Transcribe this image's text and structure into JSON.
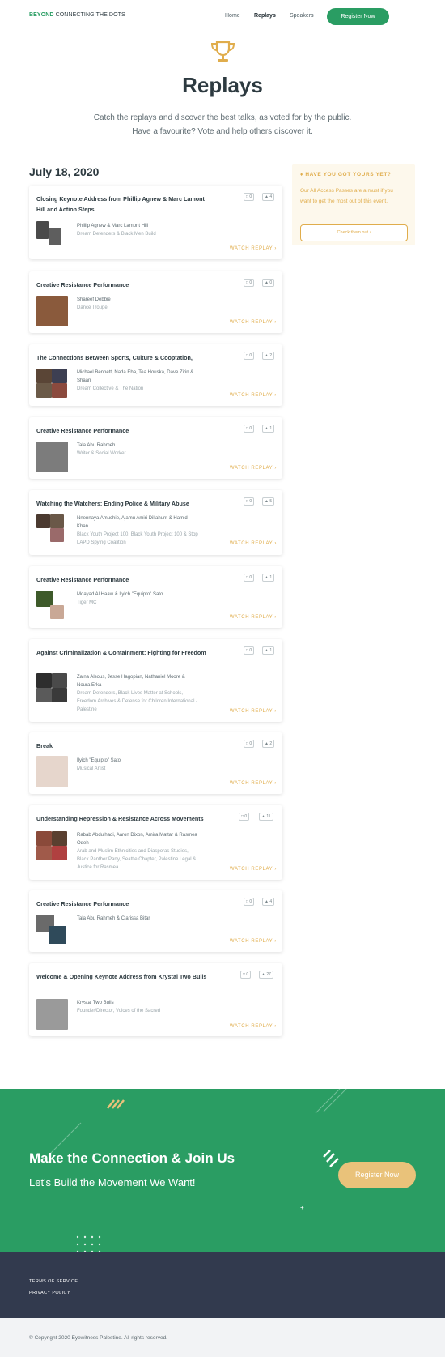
{
  "header": {
    "logo_bold": "BEYOND",
    "logo_rest": " CONNECTING THE DOTS",
    "nav": [
      "Home",
      "Replays",
      "Speakers"
    ],
    "register_label": "Register Now",
    "more_label": "···"
  },
  "hero": {
    "title": "Replays",
    "subtitle": "Catch the replays and discover the best talks, as voted for by the public. Have a favourite? Vote and help others discover it."
  },
  "date_heading": "July 18, 2020",
  "watch_label": "WATCH REPLAY ›",
  "cards": [
    {
      "title": "Closing Keynote Address from Phillip Agnew & Marc Lamont Hill and Action Steps",
      "comments": "0",
      "likes": "4",
      "names": "Phillip Agnew & Marc Lamont Hill",
      "orgs": "Dream Defenders & Black Men Build"
    },
    {
      "title": "Creative Resistance Performance",
      "comments": "0",
      "likes": "0",
      "names": "Shareef Debbie",
      "orgs": "Dance Troupe"
    },
    {
      "title": "The Connections Between Sports, Culture & Cooptation,",
      "comments": "0",
      "likes": "2",
      "names": "Michael Bennett, Nada Eba, Tea Houska, Dave Zirin & Shaan",
      "orgs": "Dream Collective & The Nation"
    },
    {
      "title": "Creative Resistance Performance",
      "comments": "0",
      "likes": "1",
      "names": "Tala Abu Rahmeh",
      "orgs": "Writer & Social Worker"
    },
    {
      "title": "Watching the Watchers: Ending Police & Military Abuse",
      "comments": "0",
      "likes": "5",
      "names": "Nnennaya Amuchie, Ajamu Amiri Dillahunt & Hamid Khan",
      "orgs": "Black Youth Project 100, Black Youth Project 100 & Stop LAPD Spying Coalition"
    },
    {
      "title": "Creative Resistance Performance",
      "comments": "0",
      "likes": "1",
      "names": "Moayad Al Haaw & Ilyich \"Equipto\" Sato",
      "orgs": "Tiger MC"
    },
    {
      "title": "Against Criminalization & Containment: Fighting for Freedom",
      "comments": "0",
      "likes": "1",
      "names": "Zaina Alsous, Jesse Hagopian, Nathaniel Moore & Noura Erka",
      "orgs": "Dream Defenders, Black Lives Matter at Schools, Freedom Archives & Defense for Children International - Palestine"
    },
    {
      "title": "Break",
      "comments": "0",
      "likes": "2",
      "names": "Ilyich \"Equipto\" Sato",
      "orgs": "Musical Artist"
    },
    {
      "title": "Understanding Repression & Resistance Across Movements",
      "comments": "0",
      "likes": "11",
      "names": "Rabab Abdulhadi, Aaron Dixon, Amira Mattar & Rasmea Odeh",
      "orgs": "Arab and Muslim Ethnicities and Diasporas Studies, Black Panther Party, Seattle Chapter, Palestine Legal & Justice for Rasmea"
    },
    {
      "title": "Creative Resistance Performance",
      "comments": "0",
      "likes": "4",
      "names": "Tala Abu Rahmeh & Clarissa Bitar",
      "orgs": ""
    },
    {
      "title": "Welcome & Opening Keynote Address from Krystal Two Bulls",
      "comments": "0",
      "likes": "27",
      "names": "Krystal Two Bulls",
      "orgs": "Founder/Director, Voices of the Sacred"
    }
  ],
  "sidebar": {
    "title": "HAVE YOU GOT YOURS YET?",
    "text": "Our All Access Passes are a must if you want to get the most out of this event.",
    "button": "Check them out ›"
  },
  "banner": {
    "title": "Make the Connection & Join Us",
    "subtitle": "Let's Build the Movement We Want!",
    "button": "Register Now"
  },
  "footer": {
    "links": [
      "TERMS OF SERVICE",
      "PRIVACY POLICY"
    ],
    "copyright": "© Copyright 2020 Eyewitness Palestine. All rights reserved."
  },
  "colors": {
    "brand_green": "#2a9d63",
    "accent_gold": "#e0ad4c",
    "footer_navy": "#323a4e"
  }
}
